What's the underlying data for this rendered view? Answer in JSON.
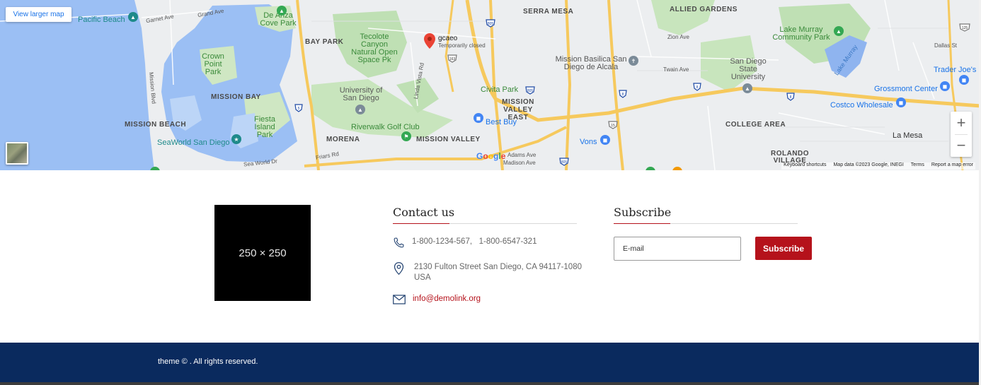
{
  "map": {
    "view_larger_label": "View larger map",
    "zoom_in": "+",
    "zoom_out": "−",
    "google_logo": [
      "G",
      "o",
      "o",
      "g",
      "l",
      "e"
    ],
    "google_colors": [
      "#4285F4",
      "#EA4335",
      "#FBBC05",
      "#4285F4",
      "#34A853",
      "#EA4335"
    ],
    "attribution": [
      "Keyboard shortcuts",
      "Map data ©2023 Google, INEGI",
      "Terms",
      "Report a map error"
    ],
    "place": {
      "name": "gcaeo",
      "status": "Temporarily closed"
    },
    "areas": [
      "SERRA MESA",
      "ALLIED GARDENS",
      "BAY PARK",
      "MISSION BAY",
      "MISSION BEACH",
      "MISSION VALLEY EAST",
      "MORENA",
      "MISSION VALLEY",
      "COLLEGE AREA",
      "ROLANDO VILLAGE",
      "PACIFIC BEACH"
    ],
    "parks": [
      "De Anza Cove Park",
      "Tecolote Canyon Natural Open Space Pk",
      "Crown Point Park",
      "Fiesta Island Park",
      "Civita Park",
      "Lake Murray Community Park",
      "Riverwalk Golf Club"
    ],
    "pois": [
      "Pacific Beach",
      "Mission Basilica San Diego de Alcala",
      "San Diego State University",
      "University of San Diego",
      "Best Buy",
      "Vons",
      "SeaWorld San Diego",
      "Costco Wholesale",
      "Grossmont Center",
      "Trader Joe's",
      "La Mesa",
      "Lake Murray"
    ],
    "roads": [
      "Garnet Ave",
      "Grand Ave",
      "Mission Blvd",
      "Linda Vista Rd",
      "Friars Rd",
      "Twain Ave",
      "Zion Ave",
      "Sea World Dr",
      "Adams Ave",
      "Madison Ave",
      "Dallas St"
    ],
    "shields": [
      "805",
      "163",
      "8",
      "15",
      "125",
      "5"
    ]
  },
  "logo_placeholder": "250 × 250",
  "contact": {
    "title": "Contact us",
    "phone": "1-800-1234-567,   1-800-6547-321",
    "address_line1": "2130 Fulton Street San Diego, CA 94117-1080",
    "address_line2": "USA",
    "email": "info@demolink.org"
  },
  "subscribe": {
    "title": "Subscribe",
    "input_placeholder": "E-mail",
    "button_label": "Subscribe"
  },
  "footer": {
    "copyright": "theme © . All rights reserved."
  },
  "colors": {
    "accent": "#b5121b",
    "footer_bg": "#0a2a5e",
    "link_blue": "#1a73e8"
  }
}
